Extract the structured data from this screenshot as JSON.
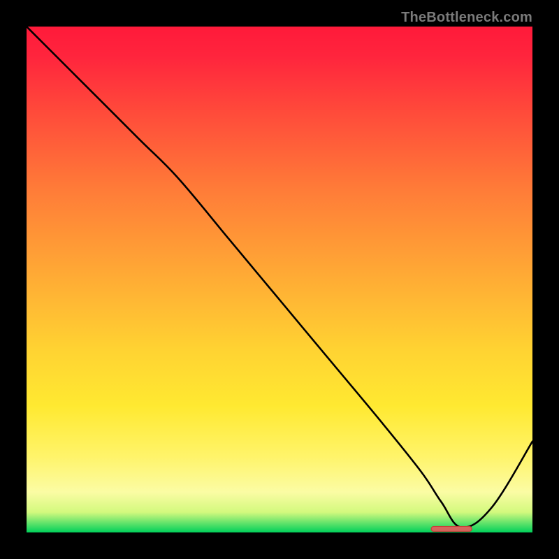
{
  "watermark": "TheBottleneck.com",
  "colors": {
    "background": "#000000",
    "curve_stroke": "#000000",
    "marker_stroke": "#ca3d3a",
    "marker_fill": "#d6645c",
    "gradient_top": "#ff1a3a",
    "gradient_mid": "#ffd332",
    "gradient_bottom": "#00d05a"
  },
  "chart_data": {
    "type": "line",
    "title": "",
    "xlabel": "",
    "ylabel": "",
    "xlim": [
      0,
      100
    ],
    "ylim": [
      0,
      100
    ],
    "grid": false,
    "legend": null,
    "series": [
      {
        "name": "bottleneck-curve",
        "x": [
          0,
          10,
          22,
          30,
          40,
          50,
          60,
          70,
          78,
          82,
          86,
          92,
          100
        ],
        "y": [
          100,
          90,
          78,
          70,
          58,
          46,
          34,
          22,
          12,
          6,
          1,
          5,
          18
        ]
      }
    ],
    "optimal_marker": {
      "name": "optimal-range",
      "x_start": 80,
      "x_end": 88,
      "y": 0.7
    },
    "annotations": []
  }
}
